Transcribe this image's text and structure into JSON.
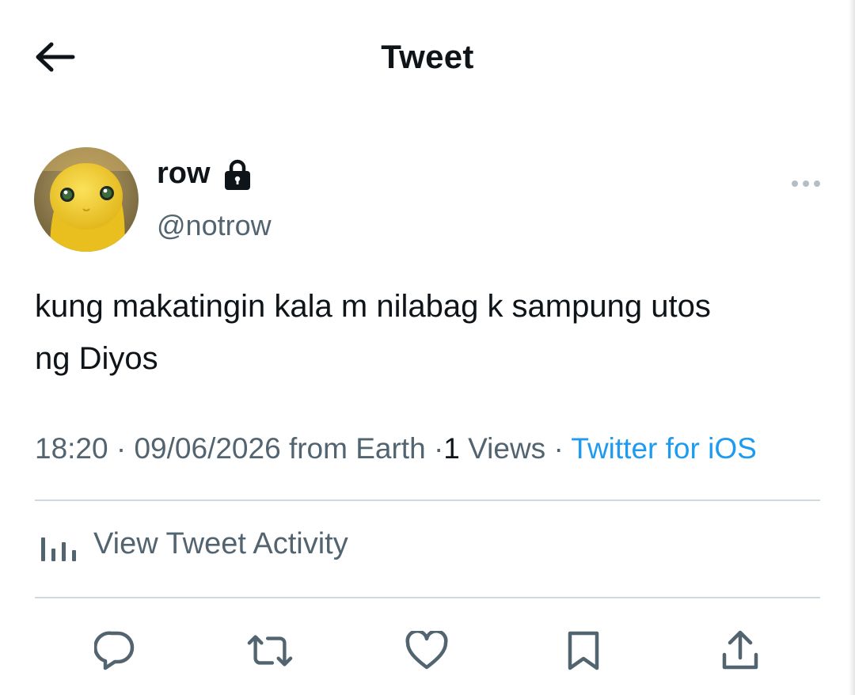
{
  "header": {
    "title": "Tweet",
    "back_icon": "arrow-left-icon"
  },
  "author": {
    "display_name": "row",
    "handle": "@notrow",
    "protected_icon": "lock-icon"
  },
  "tweet": {
    "text_line1": "kung makatingin kala m nilabag k sampung utos",
    "text_line2": "ng Diyos"
  },
  "meta": {
    "time": "18:20",
    "date": "09/06/2026",
    "from_text": "from Earth",
    "separator": "·",
    "views_count": "1",
    "views_label": "Views",
    "source": "Twitter for iOS"
  },
  "activity": {
    "label": "View Tweet Activity",
    "icon": "bar-chart-icon"
  },
  "actions": [
    {
      "name": "reply",
      "icon": "reply-icon"
    },
    {
      "name": "retweet",
      "icon": "retweet-icon"
    },
    {
      "name": "like",
      "icon": "heart-icon"
    },
    {
      "name": "bookmark",
      "icon": "bookmark-icon"
    },
    {
      "name": "share",
      "icon": "share-icon"
    }
  ],
  "colors": {
    "text_primary": "#0f1419",
    "text_secondary": "#536471",
    "link": "#1d9bf0",
    "divider": "#cfd9de",
    "avatar_yellow": "#f2cf2e"
  }
}
